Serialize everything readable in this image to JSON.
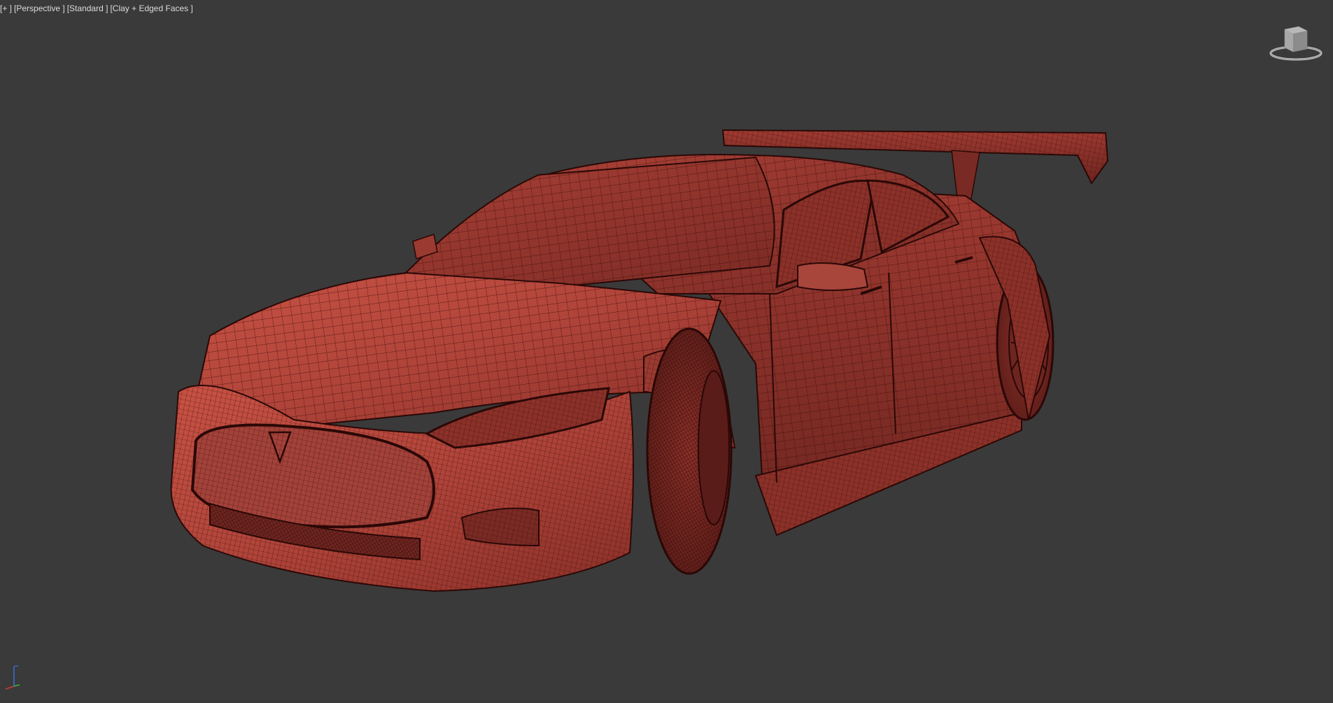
{
  "viewport": {
    "label_plus": "[+ ]",
    "label_view": "[Perspective ]",
    "label_shading_standard": "[Standard ]",
    "label_display_mode": "[Clay + Edged Faces ]"
  },
  "scene": {
    "object": "car-model",
    "material_color": "#b5463c",
    "wire_color": "#3a0d0a",
    "background_color": "#3a3a3a"
  },
  "icons": {
    "viewcube": "viewcube-icon",
    "axis_tripod": "axis-tripod-icon"
  }
}
